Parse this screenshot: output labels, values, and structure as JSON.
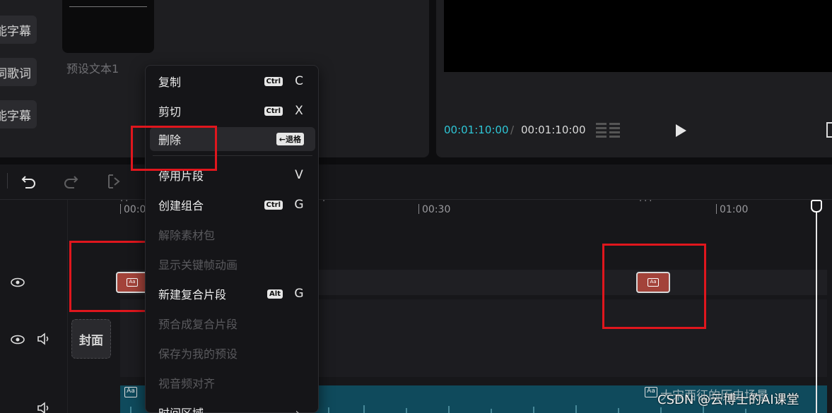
{
  "media_panel": {
    "side_buttons": [
      "能字幕",
      "词歌词",
      "能字幕"
    ],
    "preset_label": "预设文本1"
  },
  "preview": {
    "current_time": "00:01:10:00",
    "separator": "/",
    "total_time": "00:01:10:00"
  },
  "timeline": {
    "ruler": [
      "00:0",
      "00:30",
      "01:00"
    ],
    "cover_label": "封面",
    "audio_clip_label": "大宋西征的历史场景"
  },
  "context_menu": {
    "items": [
      {
        "label": "复制",
        "modifier": "Ctrl",
        "key": "C",
        "enabled": true
      },
      {
        "label": "剪切",
        "modifier": "Ctrl",
        "key": "X",
        "enabled": true
      },
      {
        "label": "删除",
        "modifier": "←退格",
        "key": "",
        "enabled": true
      },
      {
        "label": "停用片段",
        "modifier": "",
        "key": "V",
        "enabled": true
      },
      {
        "label": "创建组合",
        "modifier": "Ctrl",
        "key": "G",
        "enabled": true
      },
      {
        "label": "解除素材包",
        "modifier": "",
        "key": "",
        "enabled": false
      },
      {
        "label": "显示关键帧动画",
        "modifier": "",
        "key": "",
        "enabled": false
      },
      {
        "label": "新建复合片段",
        "modifier": "Alt",
        "key": "G",
        "enabled": true
      },
      {
        "label": "预合成复合片段",
        "modifier": "",
        "key": "",
        "enabled": false
      },
      {
        "label": "保存为我的预设",
        "modifier": "",
        "key": "",
        "enabled": false
      },
      {
        "label": "视音频对齐",
        "modifier": "",
        "key": "",
        "enabled": false
      },
      {
        "label": "时间区域",
        "modifier": "",
        "key": "",
        "enabled": true
      }
    ]
  },
  "watermark": "CSDN @云博士的AI课堂",
  "colors": {
    "accent_timecode": "#2ec6d6",
    "highlight_box": "#e0161d",
    "text_clip": "#a3433a",
    "audio_track": "#0f4a5c"
  }
}
